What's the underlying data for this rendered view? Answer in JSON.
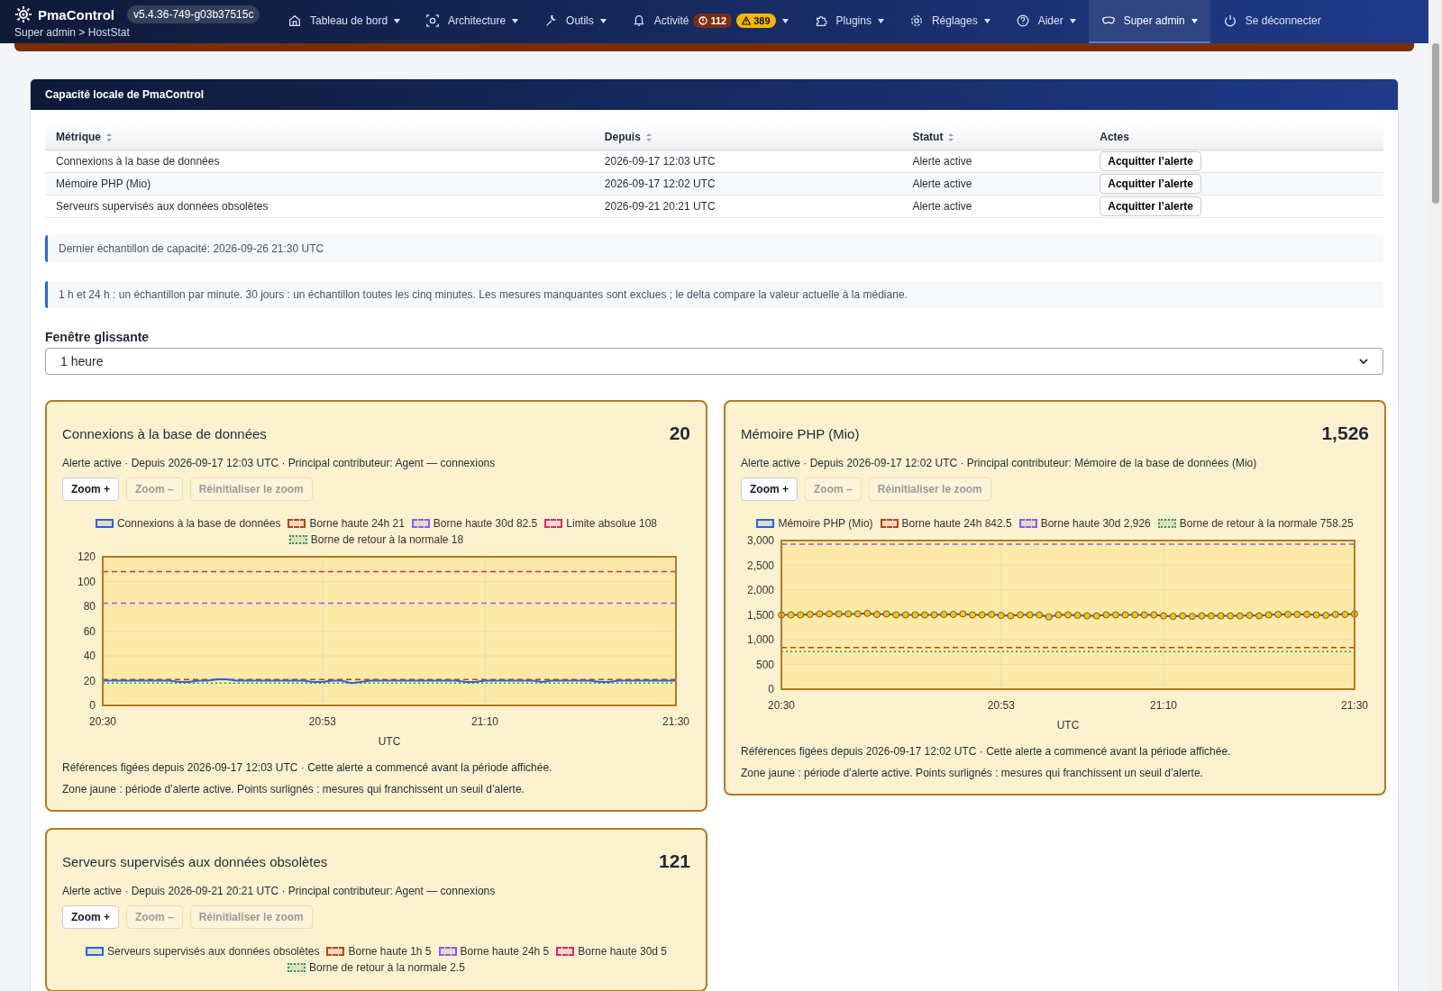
{
  "header": {
    "brand": "PmaControl",
    "version": "v5.4.36-749-g03b37515c",
    "breadcrumb": "Super admin > HostStat",
    "nav": [
      {
        "label": "Tableau de bord",
        "dropdown": true,
        "selected": false
      },
      {
        "label": "Architecture",
        "dropdown": true,
        "selected": false
      },
      {
        "label": "Outils",
        "dropdown": true,
        "selected": false
      },
      {
        "label": "Activité",
        "dropdown": true,
        "selected": false,
        "badges": [
          {
            "text": "112",
            "kind": "error"
          },
          {
            "text": "389",
            "kind": "warning"
          }
        ]
      },
      {
        "label": "Plugins",
        "dropdown": true,
        "selected": false
      },
      {
        "label": "Réglages",
        "dropdown": true,
        "selected": false
      },
      {
        "label": "Aider",
        "dropdown": true,
        "selected": false
      },
      {
        "label": "Super admin",
        "dropdown": true,
        "selected": true
      },
      {
        "label": "Se déconnecter",
        "dropdown": false,
        "selected": false
      }
    ]
  },
  "panel": {
    "title": "Capacité locale de PmaControl",
    "table": {
      "columns": [
        {
          "label": "Métrique",
          "sortable": true
        },
        {
          "label": "Depuis",
          "sortable": true
        },
        {
          "label": "Statut",
          "sortable": true
        },
        {
          "label": "Actes",
          "sortable": false
        }
      ],
      "rows": [
        {
          "cells": [
            "Connexions à la base de données",
            "2026-09-17 12:03 UTC",
            "Alerte active"
          ],
          "action": "Acquitter l’alerte"
        },
        {
          "cells": [
            "Mémoire PHP (Mio)",
            "2026-09-17 12:02 UTC",
            "Alerte active"
          ],
          "action": "Acquitter l’alerte"
        },
        {
          "cells": [
            "Serveurs supervisés aux données obsolètes",
            "2026-09-21 20:21 UTC",
            "Alerte active"
          ],
          "action": "Acquitter l’alerte"
        }
      ]
    },
    "notes": [
      "Dernier échantillon de capacité: 2026-09-26 21:30 UTC",
      "1 h et 24 h : un échantillon par minute. 30 jours : un échantillon toutes les cinq minutes. Les mesures manquantes sont exclues ; le delta compare la valeur actuelle à la médiane."
    ],
    "window_select": {
      "label": "Fenêtre glissante",
      "value": "1 heure"
    },
    "cards": [
      {
        "title": "Connexions à la base de données",
        "value": "20",
        "meta": "Alerte active · Depuis 2026-09-17 12:03 UTC · Principal contributeur: Agent — connexions",
        "buttons": [
          {
            "label": "Zoom +",
            "disabled": false
          },
          {
            "label": "Zoom –",
            "disabled": true
          },
          {
            "label": "Réinitialiser le zoom",
            "disabled": true
          }
        ],
        "chart_data": {
          "type": "line",
          "xlabel": "UTC",
          "grid": true,
          "ylim": [
            0,
            120
          ],
          "categories": [
            "20:30",
            null,
            null,
            null,
            null,
            null,
            null,
            null,
            null,
            null,
            null,
            null,
            null,
            null,
            null,
            null,
            null,
            null,
            null,
            null,
            null,
            null,
            null,
            "20:53",
            null,
            null,
            null,
            null,
            null,
            null,
            null,
            null,
            null,
            null,
            null,
            null,
            null,
            null,
            null,
            null,
            "21:10",
            null,
            null,
            null,
            null,
            null,
            null,
            null,
            null,
            null,
            null,
            null,
            null,
            null,
            null,
            null,
            null,
            null,
            null,
            null,
            "21:30"
          ],
          "yticks": [
            0,
            20,
            40,
            60,
            80,
            100,
            120
          ],
          "series": [
            {
              "name": "Connexions à la base de données",
              "color": "#2563eb",
              "values": [
                20,
                20,
                20,
                20,
                20,
                20,
                20,
                20,
                19,
                19,
                20,
                20,
                21,
                21,
                20,
                20,
                20,
                20,
                20,
                20,
                20,
                20,
                19,
                19,
                20,
                20,
                18,
                19,
                20,
                20,
                20,
                20,
                20,
                20,
                20,
                20,
                20,
                20,
                19,
                19,
                20,
                20,
                20,
                20,
                20,
                20,
                19,
                20,
                20,
                20,
                20,
                20,
                19,
                19,
                20,
                20,
                20,
                20,
                20,
                20,
                20
              ]
            }
          ],
          "ref_lines": [
            {
              "axis": "y",
              "value": 21,
              "label": "Borne haute 24h 21",
              "color": "#c2410c"
            },
            {
              "axis": "y",
              "value": 82.5,
              "label": "Borne haute 30d 82.5",
              "color": "#8b5cf6"
            },
            {
              "axis": "y",
              "value": 108,
              "label": "Limite absolue 108",
              "color": "#db2777"
            },
            {
              "axis": "y",
              "value": 18,
              "label": "Borne de retour à la normale 18",
              "color": "#16a34a"
            }
          ]
        },
        "footer": [
          "Références figées depuis 2026-09-17 12:03 UTC · Cette alerte a commencé avant la période affichée.",
          "Zone jaune : période d’alerte active. Points surlignés : mesures qui franchissent un seuil d’alerte."
        ]
      },
      {
        "title": "Mémoire PHP (Mio)",
        "value": "1,526",
        "meta": "Alerte active · Depuis 2026-09-17 12:02 UTC · Principal contributeur: Mémoire de la base de données (Mio)",
        "buttons": [
          {
            "label": "Zoom +",
            "disabled": false
          },
          {
            "label": "Zoom –",
            "disabled": true
          },
          {
            "label": "Réinitialiser le zoom",
            "disabled": true
          }
        ],
        "chart_data": {
          "type": "line",
          "xlabel": "UTC",
          "grid": true,
          "ylim": [
            0,
            3000
          ],
          "categories": [
            "20:30",
            null,
            null,
            null,
            null,
            null,
            null,
            null,
            null,
            null,
            null,
            null,
            null,
            null,
            null,
            null,
            null,
            null,
            null,
            null,
            null,
            null,
            null,
            "20:53",
            null,
            null,
            null,
            null,
            null,
            null,
            null,
            null,
            null,
            null,
            null,
            null,
            null,
            null,
            null,
            null,
            "21:10",
            null,
            null,
            null,
            null,
            null,
            null,
            null,
            null,
            null,
            null,
            null,
            null,
            null,
            null,
            null,
            null,
            null,
            null,
            null,
            "21:30"
          ],
          "yticks": [
            {
              "value": 0,
              "label": "0"
            },
            {
              "value": 500,
              "label": "500"
            },
            {
              "value": 1000,
              "label": "1,000"
            },
            {
              "value": 1500,
              "label": "1,500"
            },
            {
              "value": 2000,
              "label": "2,000"
            },
            {
              "value": 2500,
              "label": "2,500"
            },
            {
              "value": 3000,
              "label": "3,000"
            }
          ],
          "series": [
            {
              "name": "Mémoire PHP (Mio)",
              "color": "#2563eb",
              "marker": "o",
              "values": [
                1500,
                1500,
                1500,
                1510,
                1520,
                1520,
                1520,
                1520,
                1520,
                1530,
                1510,
                1520,
                1500,
                1500,
                1500,
                1500,
                1500,
                1510,
                1510,
                1520,
                1500,
                1500,
                1510,
                1490,
                1480,
                1500,
                1500,
                1500,
                1460,
                1500,
                1500,
                1490,
                1480,
                1480,
                1500,
                1500,
                1500,
                1500,
                1500,
                1500,
                1480,
                1470,
                1480,
                1470,
                1480,
                1480,
                1480,
                1480,
                1480,
                1490,
                1480,
                1500,
                1510,
                1510,
                1510,
                1510,
                1500,
                1490,
                1510,
                1510,
                1520
              ]
            }
          ],
          "ref_lines": [
            {
              "axis": "y",
              "value": 842.5,
              "label": "Borne haute 24h 842.5",
              "color": "#c2410c"
            },
            {
              "axis": "y",
              "value": 2926,
              "label": "Borne haute 30d 2,926",
              "color": "#8b5cf6"
            },
            {
              "axis": "y",
              "value": 758.25,
              "label": "Borne de retour à la normale 758.25",
              "color": "#16a34a"
            }
          ]
        },
        "footer": [
          "Références figées depuis 2026-09-17 12:02 UTC · Cette alerte a commencé avant la période affichée.",
          "Zone jaune : période d’alerte active. Points surlignés : mesures qui franchissent un seuil d’alerte."
        ]
      },
      {
        "title": "Serveurs supervisés aux données obsolètes",
        "value": "121",
        "meta": "Alerte active · Depuis 2026-09-21 20:21 UTC · Principal contributeur: Agent — connexions",
        "buttons": [
          {
            "label": "Zoom +",
            "disabled": false
          },
          {
            "label": "Zoom –",
            "disabled": true
          },
          {
            "label": "Réinitialiser le zoom",
            "disabled": true
          }
        ],
        "legend": [
          {
            "label": "Serveurs supervisés aux données obsolètes",
            "color": "#2563eb"
          },
          {
            "label": "Borne haute 1h 5",
            "color": "#c2410c"
          },
          {
            "label": "Borne haute 24h 5",
            "color": "#8b5cf6"
          },
          {
            "label": "Borne haute 30d 5",
            "color": "#db2777"
          },
          {
            "label": "Borne de retour à la normale 2.5",
            "color": "#16a34a"
          }
        ]
      }
    ]
  }
}
